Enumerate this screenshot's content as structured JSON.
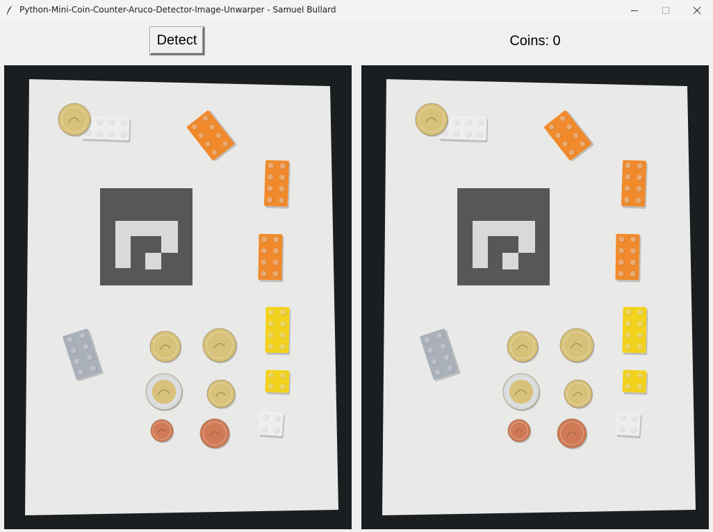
{
  "window": {
    "title": "Python-Mini-Coin-Counter-Aruco-Detector-Image-Unwarper - Samuel Bullard",
    "app_icon": "feather-icon",
    "controls": {
      "minimize_icon": "minimize-icon",
      "maximize_icon": "maximize-icon",
      "close_icon": "close-icon"
    }
  },
  "toolbar": {
    "detect_label": "Detect",
    "coins_label": "Coins: 0"
  },
  "panels": {
    "left": {
      "name": "original-image"
    },
    "right": {
      "name": "processed-image"
    }
  },
  "colors": {
    "window_bg": "#f0f0f0",
    "panel_bg": "#1a1e21",
    "paper": "#e9e9e7",
    "aruco_dark": "#575757",
    "aruco_light": "#d9d9d9",
    "lego_white": "#eeeeee",
    "lego_orange": "#f08a2c",
    "lego_yellow": "#f3d21e",
    "lego_grey": "#a9b0ba",
    "coin_gold": "#d8c27a",
    "coin_copper": "#d07a55",
    "coin_bimetal": "#d9dadb"
  }
}
